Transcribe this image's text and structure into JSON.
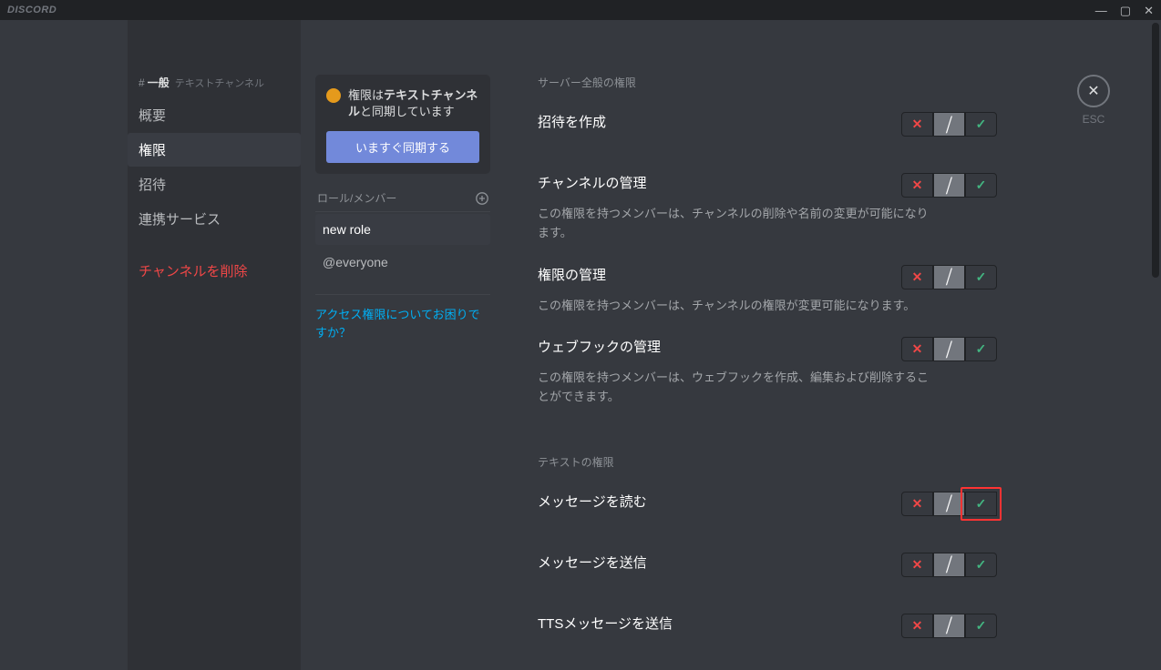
{
  "titlebar": {
    "brand": "DISCORD"
  },
  "sidebar": {
    "hash": "#",
    "channel_name": "一般",
    "channel_type": "テキストチャンネル",
    "items": [
      {
        "label": "概要"
      },
      {
        "label": "権限"
      },
      {
        "label": "招待"
      },
      {
        "label": "連携サービス"
      }
    ],
    "delete": "チャンネルを削除"
  },
  "roles": {
    "sync_text_prefix": "権限は",
    "sync_text_bold": "テキストチャンネル",
    "sync_text_suffix": "と同期しています",
    "sync_button": "いますぐ同期する",
    "header": "ロール/メンバー",
    "list": [
      {
        "name": "new role"
      },
      {
        "name": "@everyone"
      }
    ],
    "help": "アクセス権限についてお困りですか？"
  },
  "perms": {
    "section_server": "サーバー全般の権限",
    "section_text": "テキストの権限",
    "items": {
      "create_invite": {
        "label": "招待を作成"
      },
      "manage_channel": {
        "label": "チャンネルの管理",
        "desc": "この権限を持つメンバーは、チャンネルの削除や名前の変更が可能になります。"
      },
      "manage_perms": {
        "label": "権限の管理",
        "desc": "この権限を持つメンバーは、チャンネルの権限が変更可能になります。"
      },
      "manage_webhooks": {
        "label": "ウェブフックの管理",
        "desc": "この権限を持つメンバーは、ウェブフックを作成、編集および削除することができます。"
      },
      "read_messages": {
        "label": "メッセージを読む"
      },
      "send_messages": {
        "label": "メッセージを送信"
      },
      "send_tts": {
        "label": "TTSメッセージを送信"
      }
    }
  },
  "close": {
    "label": "ESC"
  }
}
